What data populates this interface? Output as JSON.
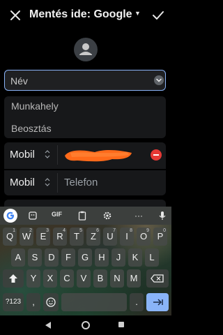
{
  "header": {
    "title": "Mentés ide: Google",
    "close_icon": "close-icon",
    "save_icon": "check-icon",
    "account_menu_icon": "caret-down-icon"
  },
  "avatar": {
    "icon": "person-icon"
  },
  "form": {
    "name_placeholder": "Név",
    "company_placeholder": "Munkahely",
    "title_placeholder": "Beosztás",
    "phones": [
      {
        "type": "Mobil",
        "value": "",
        "redacted": true
      },
      {
        "type": "Mobil",
        "placeholder": "Telefon"
      }
    ]
  },
  "keyboard": {
    "toolbar": {
      "gif_label": "GIF",
      "more_label": "···"
    },
    "row1": [
      "Q",
      "W",
      "E",
      "R",
      "T",
      "Z",
      "U",
      "I",
      "O",
      "P"
    ],
    "row1_numbers": [
      "1",
      "2",
      "3",
      "4",
      "5",
      "6",
      "7",
      "8",
      "9",
      "0"
    ],
    "row2": [
      "A",
      "S",
      "D",
      "F",
      "G",
      "H",
      "J",
      "K",
      "L"
    ],
    "row3": [
      "Y",
      "X",
      "C",
      "V",
      "B",
      "N",
      "M"
    ],
    "bottom": {
      "symbols_label": "?123",
      "comma_label": ",",
      "period_label": "."
    },
    "colors": {
      "enter_key": "#8ab4f8",
      "accent_border": "#8ab4f8",
      "remove_button": "#e53935",
      "redaction": "#ff6a1a"
    }
  },
  "navigation": {
    "back_icon": "back-triangle-icon",
    "home_icon": "home-circle-icon",
    "recents_icon": "recents-square-icon"
  }
}
